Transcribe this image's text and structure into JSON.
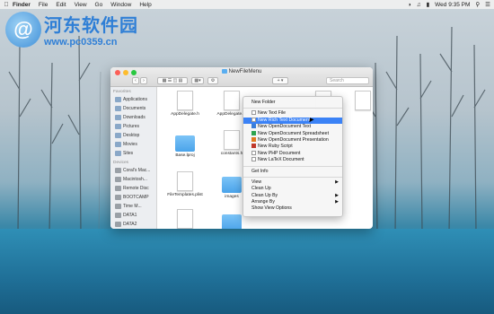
{
  "menubar": {
    "items": [
      "Finder",
      "File",
      "Edit",
      "View",
      "Go",
      "Window",
      "Help"
    ],
    "clock": "Wed 9:35 PM"
  },
  "watermark": {
    "title": "河东软件园",
    "url": "www.pc0359.cn"
  },
  "window": {
    "title": "NewFileMenu",
    "search_placeholder": "Search"
  },
  "sidebar": {
    "favorites_heading": "Favorites",
    "favorites": [
      "Applications",
      "Documents",
      "Downloads",
      "Pictures",
      "Desktop",
      "Movies",
      "Sites"
    ],
    "devices_heading": "Devices",
    "devices": [
      "Coral's Mac...",
      "Macintosh...",
      "Remote Disc",
      "BOOTCAMP",
      "Time M...",
      "DATA1",
      "DATA2"
    ]
  },
  "files": [
    "AppDelegate.h",
    "AppDelegate.m",
    "Base.lproj",
    "constants.h",
    "FileTemplates.plist",
    "images"
  ],
  "context_menu": {
    "new_folder": "New Folder",
    "new_items": [
      "New Text File",
      "New Rich Text Document",
      "New OpenDocument Text",
      "New OpenDocument Spreadsheet",
      "New OpenDocument Presentation",
      "New Ruby Script",
      "New PHP Document",
      "New LaTeX Document"
    ],
    "highlighted_index": 1,
    "get_info": "Get Info",
    "view_items": [
      "View",
      "Clean Up",
      "Clean Up By",
      "Arrange By",
      "Show View Options"
    ]
  }
}
